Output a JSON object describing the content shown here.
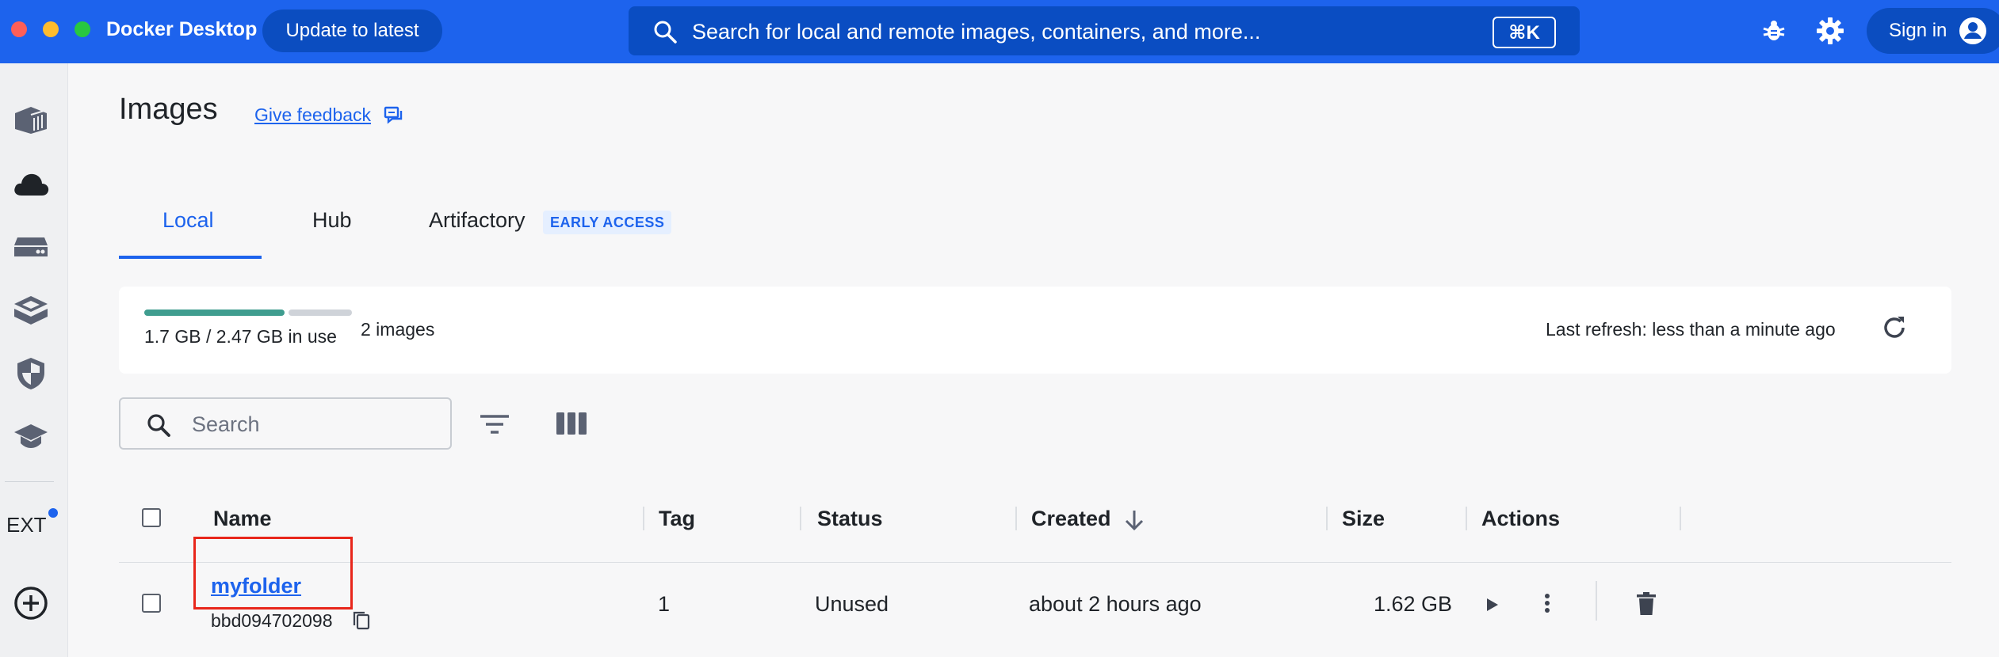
{
  "topbar": {
    "app_title": "Docker Desktop",
    "update_label": "Update to latest",
    "search_placeholder": "Search for local and remote images, containers, and more...",
    "shortcut": "⌘K",
    "sign_in_label": "Sign in",
    "background_color": "#1d63ed"
  },
  "sidebar": {
    "items": [
      {
        "icon": "containers-icon"
      },
      {
        "icon": "cloud-icon"
      },
      {
        "icon": "volumes-icon"
      },
      {
        "icon": "builds-icon"
      },
      {
        "icon": "scout-shield-icon"
      },
      {
        "icon": "learning-center-icon"
      }
    ],
    "extensions_label": "EXT",
    "add_extension_icon": "add-circle-icon"
  },
  "header": {
    "title": "Images",
    "feedback_label": "Give feedback"
  },
  "tabs": [
    {
      "label": "Local",
      "active": true
    },
    {
      "label": "Hub",
      "active": false
    },
    {
      "label": "Artifactory",
      "active": false,
      "badge": "EARLY ACCESS"
    }
  ],
  "storage": {
    "usage_text": "1.7 GB / 2.47 GB in use",
    "usage_fraction": 0.69,
    "images_count": "2 images",
    "last_refresh": "Last refresh: less than a minute ago",
    "used_color": "#3f9d8f"
  },
  "toolbar": {
    "search_placeholder": "Search"
  },
  "table": {
    "columns": [
      "Name",
      "Tag",
      "Status",
      "Created",
      "Size",
      "Actions"
    ],
    "sort_column": "Created",
    "rows": [
      {
        "name": "myfolder",
        "id": "bbd094702098",
        "tag": "1",
        "status": "Unused",
        "created": "about 2 hours ago",
        "size": "1.62 GB"
      }
    ]
  },
  "colors": {
    "accent": "#1d63ed",
    "highlight": "#e8261b"
  }
}
